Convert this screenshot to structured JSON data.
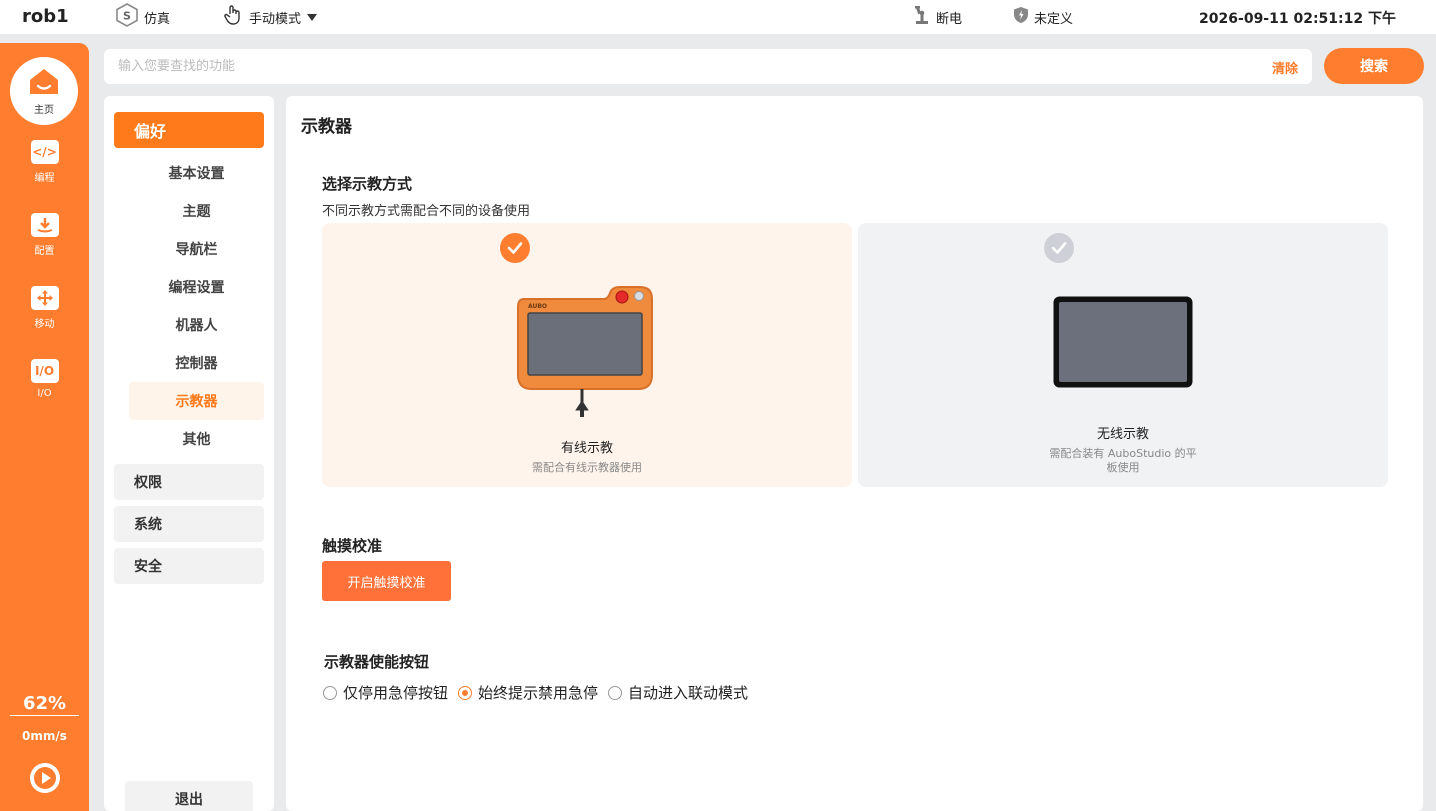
{
  "topbar": {
    "robot_name": "rob1",
    "sim_mode": "仿真",
    "hand_mode": "手动模式",
    "power": "断电",
    "safety": "未定义",
    "datetime": "2026-09-11 02:51:12 下午"
  },
  "rail": {
    "home": "主页",
    "items": [
      "编程",
      "配置",
      "移动",
      "I/O"
    ],
    "io_badge": "I/O",
    "speed_pct": "62%",
    "speed": "0mm/s"
  },
  "search": {
    "placeholder": "输入您要查找的功能",
    "clear": "清除",
    "button": "搜索"
  },
  "nav": {
    "active_category": "偏好",
    "sub_items": [
      "基本设置",
      "主题",
      "导航栏",
      "编程设置",
      "机器人",
      "控制器",
      "示教器",
      "其他"
    ],
    "active_sub": "示教器",
    "categories": [
      "权限",
      "系统",
      "安全"
    ],
    "logout": "退出"
  },
  "main": {
    "title": "示教器",
    "mode_section": {
      "title": "选择示教方式",
      "desc": "不同示教方式需配合不同的设备使用",
      "wired": {
        "name": "有线示教",
        "desc": "需配合有线示教器使用",
        "selected": true,
        "brand": "AUBO"
      },
      "wireless": {
        "name": "无线示教",
        "desc_line1": "需配合装有 AuboStudio 的平",
        "desc_line2": "板使用",
        "selected": false
      }
    },
    "touch_section": {
      "title": "触摸校准",
      "button": "开启触摸校准"
    },
    "enable_section": {
      "title": "示教器使能按钮",
      "options": [
        "仅停用急停按钮",
        "始终提示禁用急停",
        "自动进入联动模式"
      ],
      "selected_index": 1
    }
  },
  "colors": {
    "accent": "#ff7d2e",
    "selected_card": "#fff4ec",
    "unselected_card": "#f1f2f4"
  }
}
